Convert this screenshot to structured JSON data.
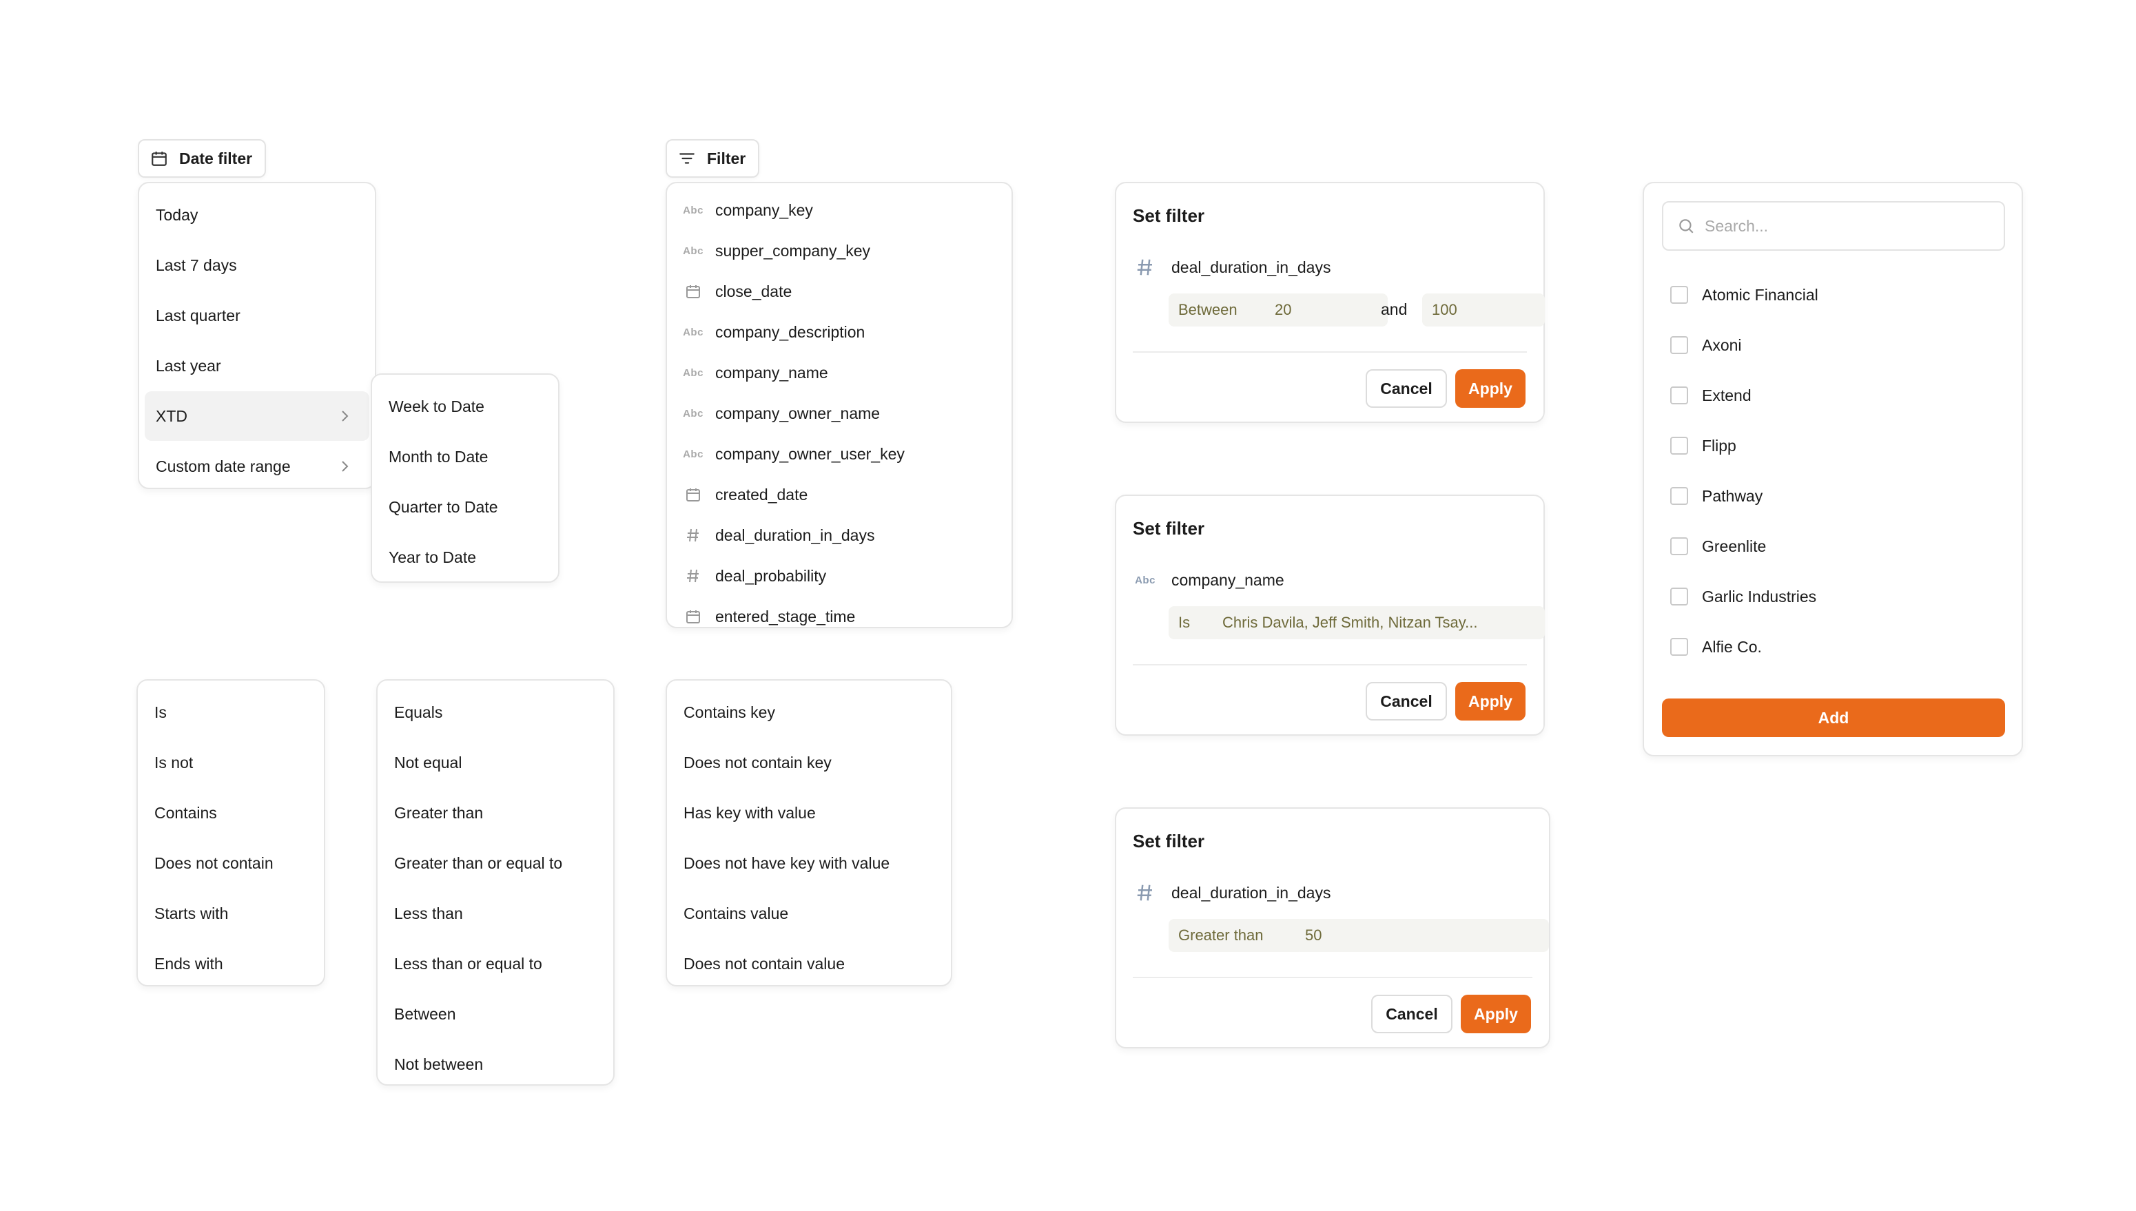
{
  "date_filter": {
    "trigger_label": "Date filter",
    "items": [
      {
        "label": "Today"
      },
      {
        "label": "Last 7 days"
      },
      {
        "label": "Last quarter"
      },
      {
        "label": "Last year"
      },
      {
        "label": "XTD",
        "active": true,
        "submenu": true
      },
      {
        "label": "Custom date range",
        "submenu": true
      }
    ],
    "submenu_items": [
      {
        "label": "Week to Date"
      },
      {
        "label": "Month to Date"
      },
      {
        "label": "Quarter to Date"
      },
      {
        "label": "Year to Date"
      }
    ]
  },
  "field_filter": {
    "trigger_label": "Filter",
    "fields": [
      {
        "type": "text",
        "icon": "Abc",
        "label": "company_key"
      },
      {
        "type": "text",
        "icon": "Abc",
        "label": "supper_company_key"
      },
      {
        "type": "date",
        "label": "close_date"
      },
      {
        "type": "text",
        "icon": "Abc",
        "label": "company_description"
      },
      {
        "type": "text",
        "icon": "Abc",
        "label": "company_name"
      },
      {
        "type": "text",
        "icon": "Abc",
        "label": "company_owner_name"
      },
      {
        "type": "text",
        "icon": "Abc",
        "label": "company_owner_user_key"
      },
      {
        "type": "date",
        "label": "created_date"
      },
      {
        "type": "number",
        "label": "deal_duration_in_days"
      },
      {
        "type": "number",
        "label": "deal_probability"
      },
      {
        "type": "date",
        "label": "entered_stage_time"
      }
    ]
  },
  "text_operators": [
    "Is",
    "Is not",
    "Contains",
    "Does not contain",
    "Starts with",
    "Ends with"
  ],
  "number_operators": [
    "Equals",
    "Not equal",
    "Greater than",
    "Greater than or equal to",
    "Less than",
    "Less than or equal to",
    "Between",
    "Not between"
  ],
  "key_operators": [
    "Contains key",
    "Does not contain key",
    "Has key with value",
    "Does not have key with value",
    "Contains value",
    "Does not contain value"
  ],
  "set_filter_1": {
    "title": "Set filter",
    "field": "deal_duration_in_days",
    "operator": "Between",
    "value_from": "20",
    "and_label": "and",
    "value_to": "100",
    "cancel": "Cancel",
    "apply": "Apply"
  },
  "set_filter_2": {
    "title": "Set filter",
    "field_icon": "Abc",
    "field": "company_name",
    "operator": "Is",
    "value": "Chris Davila, Jeff Smith, Nitzan Tsay...",
    "cancel": "Cancel",
    "apply": "Apply"
  },
  "set_filter_3": {
    "title": "Set filter",
    "field": "deal_duration_in_days",
    "operator": "Greater than",
    "value": "50",
    "cancel": "Cancel",
    "apply": "Apply"
  },
  "company_picker": {
    "search_placeholder": "Search...",
    "options": [
      "Atomic Financial",
      "Axoni",
      "Extend",
      "Flipp",
      "Pathway",
      "Greenlite",
      "Garlic Industries",
      "Alfie Co."
    ],
    "add_label": "Add"
  },
  "colors": {
    "accent": "#ea6a1b",
    "border": "#e5e5e5",
    "pill_bg": "#f4f4f1",
    "pill_text": "#6e6a3a"
  },
  "icons": {
    "date_filter": "calendar-icon",
    "filter": "filter-lines-icon",
    "search": "search-icon",
    "number": "hash-icon",
    "submenu": "chevron-right-icon"
  }
}
